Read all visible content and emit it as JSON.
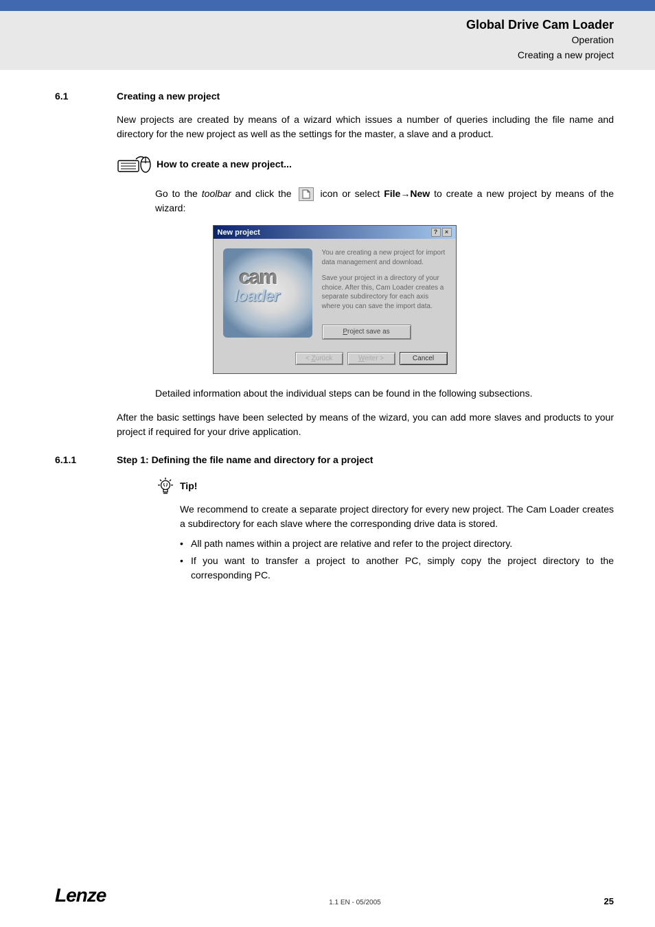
{
  "header": {
    "title": "Global Drive Cam Loader",
    "sub1": "Operation",
    "sub2": "Creating a new project"
  },
  "section61": {
    "num": "6.1",
    "title": "Creating a new project",
    "intro": "New projects are created by means of a wizard which issues a number of queries including the file name and directory for the new project as well as the settings for the master, a slave and a product.",
    "howto": "How to create a new project...",
    "goto_pre": "Go to the ",
    "goto_toolbar": "toolbar",
    "goto_mid": " and click the ",
    "goto_post1": " icon or select ",
    "goto_file": "File",
    "goto_arrow": "→",
    "goto_new": "New",
    "goto_post2": " to create a new project by means of the wizard:",
    "detailed": "Detailed information about the individual steps can be found in the following subsections.",
    "after": "After the basic settings have been selected by means of the wizard, you can add more slaves and products to your project if required for your drive application."
  },
  "wizard": {
    "title": "New project",
    "logo_cam": "cam",
    "logo_loader": "loader",
    "text1": "You are creating a new project for import data management and download.",
    "text2": "Save your project in a directory of your choice. After this, Cam Loader creates a separate subdirectory for each axis where you can save the import data.",
    "save_p": "P",
    "save_rest": "roject save as",
    "back_lt": "< ",
    "back_z": "Z",
    "back_rest": "urück",
    "next_w": "W",
    "next_rest": "eiter >",
    "cancel": "Cancel"
  },
  "section611": {
    "num": "6.1.1",
    "title": "Step 1: Defining the file name and directory for a project",
    "tip_label": "Tip!",
    "tip_body": "We recommend to create a separate project directory for every new project. The Cam Loader creates a subdirectory for each slave where the corresponding drive data is stored.",
    "bullet1": "All path names within a project are relative and refer to the project directory.",
    "bullet2": "If you want to transfer a project to another PC, simply copy the project directory to the corresponding PC."
  },
  "footer": {
    "logo": "Lenze",
    "center": "1.1 EN - 05/2005",
    "page": "25"
  }
}
